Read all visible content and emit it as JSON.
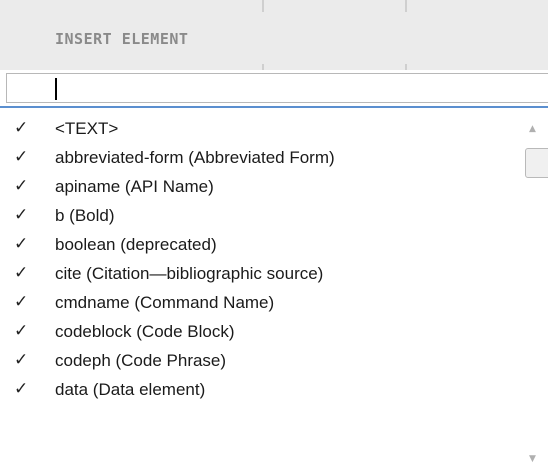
{
  "header": {
    "title": "INSERT ELEMENT"
  },
  "search": {
    "value": "",
    "placeholder": ""
  },
  "scrollbar": {
    "up_glyph": "▲",
    "down_glyph": "▼"
  },
  "list": {
    "check_glyph": "✓",
    "items": [
      {
        "label": "<TEXT>"
      },
      {
        "label": "abbreviated-form (Abbreviated Form)"
      },
      {
        "label": "apiname (API Name)"
      },
      {
        "label": "b (Bold)"
      },
      {
        "label": "boolean (deprecated)"
      },
      {
        "label": "cite (Citation—bibliographic source)"
      },
      {
        "label": "cmdname (Command Name)"
      },
      {
        "label": "codeblock (Code Block)"
      },
      {
        "label": "codeph (Code Phrase)"
      },
      {
        "label": "data (Data element)"
      }
    ]
  }
}
